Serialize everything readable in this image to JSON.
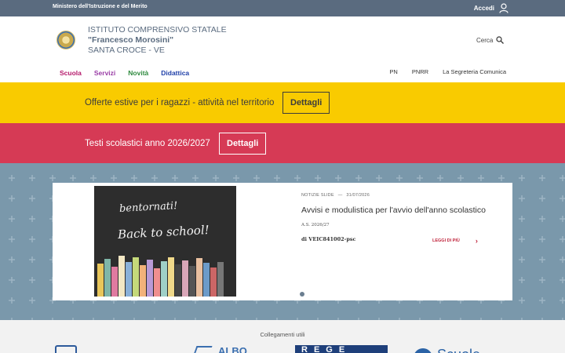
{
  "topbar": {
    "ministry": "Ministero dell'Istruzione e del Merito",
    "login_label": "Accedi"
  },
  "header": {
    "school_line1": "ISTITUTO COMPRENSIVO STATALE",
    "school_name": "\"Francesco Morosini\"",
    "school_place": "SANTA CROCE - VE",
    "search_label": "Cerca"
  },
  "nav": {
    "items": [
      {
        "label": "Scuola",
        "color": "#b5196b"
      },
      {
        "label": "Servizi",
        "color": "#9a3ea6"
      },
      {
        "label": "Novità",
        "color": "#2e8a3e"
      },
      {
        "label": "Didattica",
        "color": "#1f3fa8"
      }
    ],
    "sublinks": [
      "PN",
      "PNRR",
      "La Segreteria Comunica"
    ]
  },
  "banners": [
    {
      "text": "Offerte estive per i ragazzi - attività nel territorio",
      "button": "Dettagli",
      "color": "#f9cb00"
    },
    {
      "text": "Testi scolastici anno 2026/2027",
      "button": "Dettagli",
      "color": "#d63a55"
    }
  ],
  "slide": {
    "image_text_1": "bentornati!",
    "image_text_2": "Back to school!",
    "category": "NOTIZIE SLIDE",
    "date": "31/07/2026",
    "title": "Avvisi e modulistica per l'avvio dell'anno scolastico",
    "subtitle": "A.S. 2026/27",
    "author": "di VEIC841002-psc",
    "read_more": "LEGGI DI PIÙ"
  },
  "footer": {
    "title": "Collegamenti utili",
    "logo_2_text": "ALBO",
    "logo_3_text": "REGE",
    "logo_4_text": "Scuole"
  },
  "colors": {
    "topbar": "#5a6b7f",
    "pattern_bg": "#7a98ab",
    "accent_red": "#c0253d"
  }
}
